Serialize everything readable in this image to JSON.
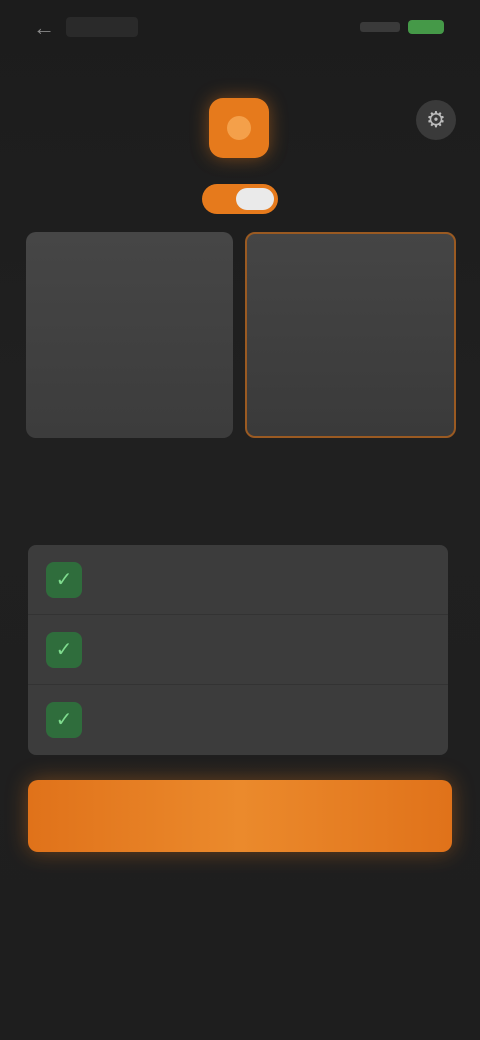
{
  "status": {
    "back_icon": "back-arrow-icon"
  },
  "header": {
    "logo_icon": "app-logo-icon",
    "settings_icon": "gear-icon"
  },
  "billing_toggle": {
    "left_label": "",
    "right_label": "",
    "on": true
  },
  "plans": [
    {
      "price": "",
      "period": "",
      "note": ""
    },
    {
      "price": "",
      "period": "",
      "note": "",
      "selected": true
    }
  ],
  "plans_caption": "",
  "features_title": "",
  "features": [
    {
      "icon": "check-icon",
      "text": ""
    },
    {
      "icon": "check-icon",
      "text": ""
    },
    {
      "icon": "check-icon",
      "text": ""
    }
  ],
  "cta_label": "",
  "restore_label": "",
  "legal_text": "",
  "links": {
    "terms": "",
    "privacy": ""
  },
  "colors": {
    "accent": "#e67a1c",
    "check": "#2f6d3c",
    "background": "#1e1e1e"
  }
}
